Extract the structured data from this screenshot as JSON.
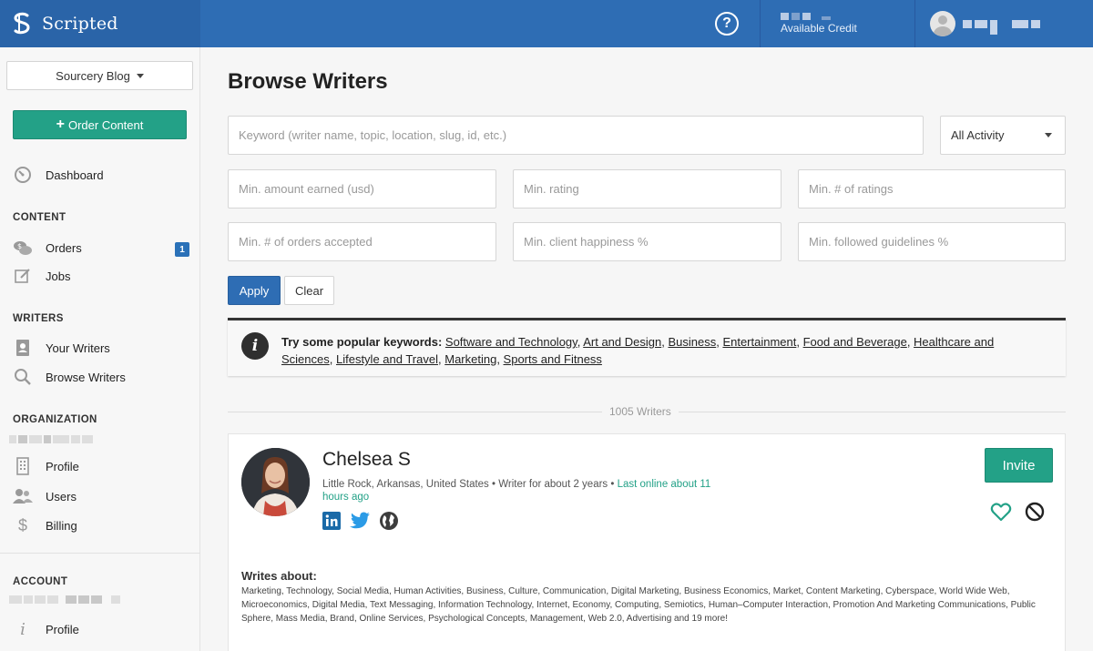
{
  "topbar": {
    "brand": "Scripted",
    "help_icon": "question-circle-icon",
    "credit_label": "Available Credit"
  },
  "sidebar": {
    "blog_select": "Sourcery Blog",
    "order_button": "Order Content",
    "dashboard": "Dashboard",
    "sections": {
      "content": "CONTENT",
      "writers": "WRITERS",
      "organization": "ORGANIZATION",
      "account": "ACCOUNT"
    },
    "items": {
      "orders": "Orders",
      "orders_badge": "1",
      "jobs": "Jobs",
      "your_writers": "Your Writers",
      "browse_writers": "Browse Writers",
      "org_profile": "Profile",
      "users": "Users",
      "billing": "Billing",
      "account_profile": "Profile"
    }
  },
  "main": {
    "title": "Browse Writers",
    "keyword_placeholder": "Keyword (writer name, topic, location, slug, id, etc.)",
    "activity_select": "All Activity",
    "filters": {
      "min_amount": "Min. amount earned (usd)",
      "min_rating": "Min. rating",
      "min_ratings_count": "Min. # of ratings",
      "min_orders": "Min. # of orders accepted",
      "min_happiness": "Min. client happiness %",
      "min_guidelines": "Min. followed guidelines %"
    },
    "apply_label": "Apply",
    "clear_label": "Clear",
    "popular": {
      "prefix": "Try some popular keywords:",
      "keywords": [
        "Software and Technology",
        "Art and Design",
        "Business",
        "Entertainment",
        "Food and Beverage",
        "Healthcare and Sciences",
        "Lifestyle and Travel",
        "Marketing",
        "Sports and Fitness"
      ]
    },
    "writer_count": "1005 Writers",
    "writer": {
      "name": "Chelsea S",
      "location_meta": "Little Rock, Arkansas, United States • Writer for about 2 years • ",
      "last_online": "Last online about 11 hours ago",
      "invite_label": "Invite",
      "writes_about_label": "Writes about:",
      "writes_about": "Marketing, Technology, Social Media, Human Activities, Business, Culture, Communication, Digital Marketing, Business Economics, Market, Content Marketing, Cyberspace, World Wide Web, Microeconomics, Digital Media, Text Messaging, Information Technology, Internet, Economy, Computing, Semiotics, Human–Computer Interaction, Promotion And Marketing Communications, Public Sphere, Mass Media, Brand, Online Services, Psychological Concepts, Management, Web 2.0, Advertising and 19 more!"
    }
  },
  "colors": {
    "topbar": "#2e6db4",
    "accent_green": "#23a187",
    "badge_blue": "#2a71b8"
  }
}
